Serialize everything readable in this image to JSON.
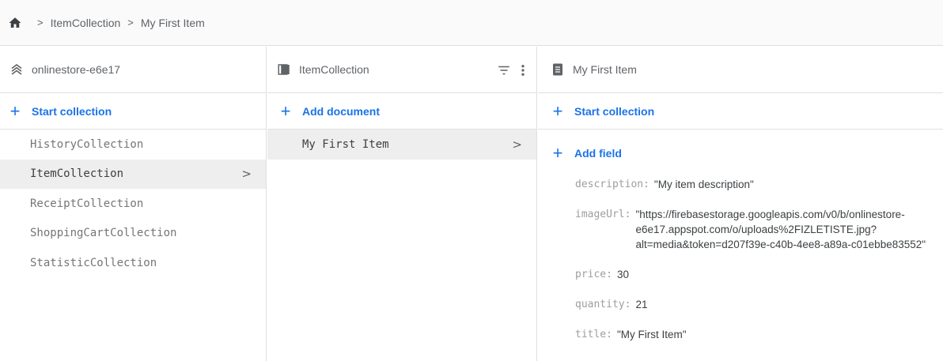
{
  "breadcrumb": {
    "items": [
      "ItemCollection",
      "My First Item"
    ]
  },
  "root_panel": {
    "title": "onlinestore-e6e17",
    "action_label": "Start collection",
    "collections": [
      {
        "name": "HistoryCollection",
        "selected": false
      },
      {
        "name": "ItemCollection",
        "selected": true
      },
      {
        "name": "ReceiptCollection",
        "selected": false
      },
      {
        "name": "ShoppingCartCollection",
        "selected": false
      },
      {
        "name": "StatisticCollection",
        "selected": false
      }
    ]
  },
  "collection_panel": {
    "title": "ItemCollection",
    "action_label": "Add document",
    "documents": [
      {
        "name": "My First Item",
        "selected": true
      }
    ]
  },
  "document_panel": {
    "title": "My First Item",
    "start_collection_label": "Start collection",
    "add_field_label": "Add field",
    "fields": [
      {
        "key": "description:",
        "value": "\"My item description\""
      },
      {
        "key": "imageUrl:",
        "value": "\"https://firebasestorage.googleapis.com/v0/b/onlinestore-\ne6e17.appspot.com/o/uploads%2FIZLETISTE.jpg?\nalt=media&token=d207f39e-c40b-4ee8-a89a-c01ebbe83552\""
      },
      {
        "key": "price:",
        "value": "30"
      },
      {
        "key": "quantity:",
        "value": "21"
      },
      {
        "key": "title:",
        "value": "\"My First Item\""
      }
    ]
  },
  "colors": {
    "accent": "#1a73e8",
    "selected_row": "#eeeeee",
    "border": "#e0e0e0"
  }
}
